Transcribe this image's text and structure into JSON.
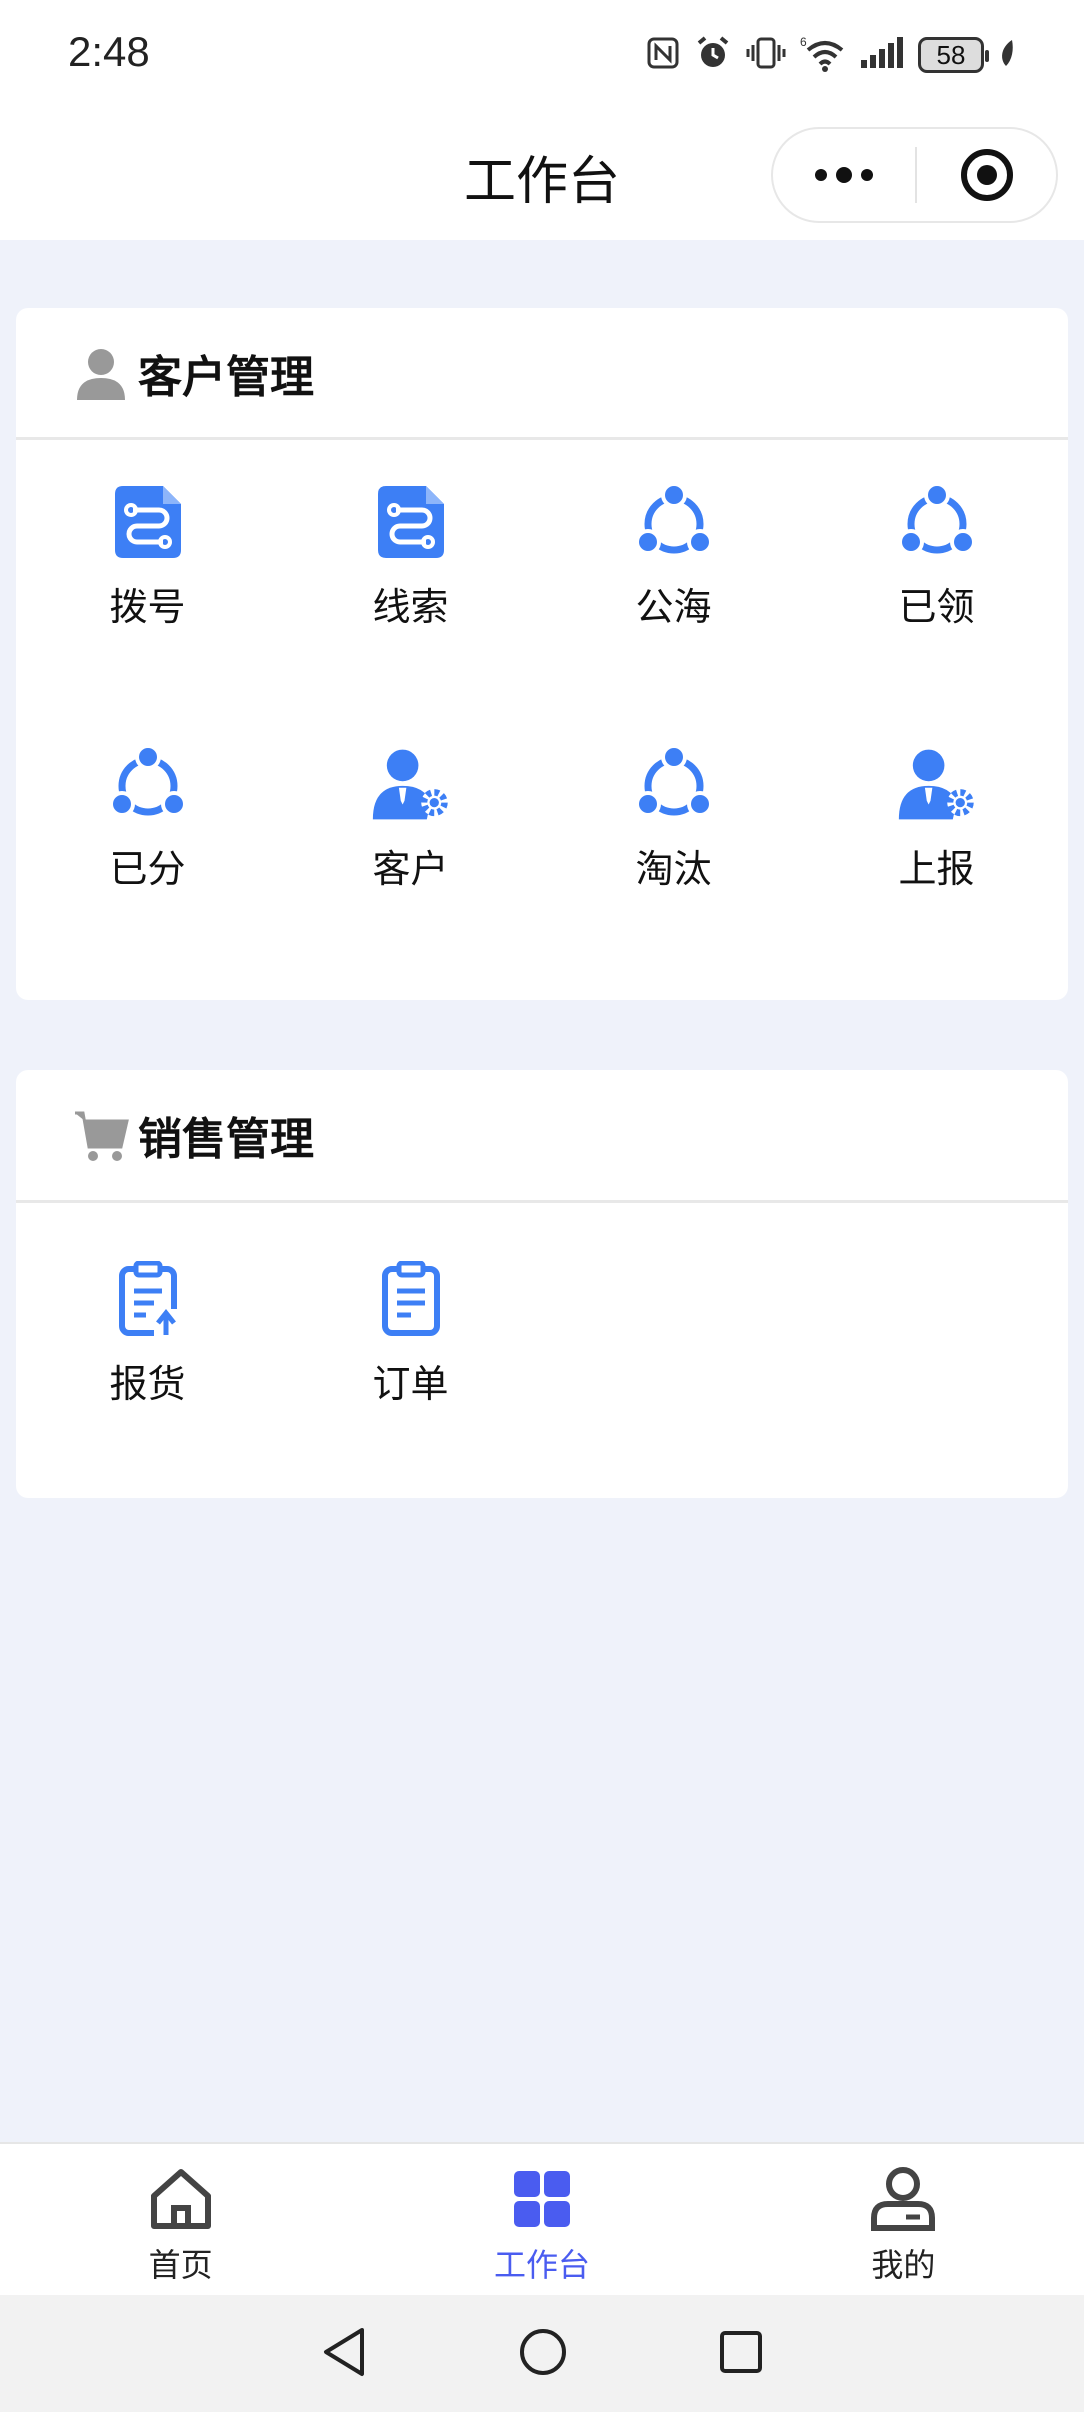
{
  "status_bar": {
    "time": "2:48",
    "battery": "58",
    "network": "6"
  },
  "nav": {
    "title": "工作台"
  },
  "customer_section": {
    "title": "客户管理",
    "items": [
      {
        "label": "拨号",
        "icon": "route-doc-icon"
      },
      {
        "label": "线索",
        "icon": "route-doc-icon"
      },
      {
        "label": "公海",
        "icon": "share-nodes-icon"
      },
      {
        "label": "已领",
        "icon": "share-nodes-icon"
      },
      {
        "label": "已分",
        "icon": "share-nodes-icon"
      },
      {
        "label": "客户",
        "icon": "user-gear-icon"
      },
      {
        "label": "淘汰",
        "icon": "share-nodes-icon"
      },
      {
        "label": "上报",
        "icon": "user-gear-icon"
      }
    ]
  },
  "sales_section": {
    "title": "销售管理",
    "items": [
      {
        "label": "报货",
        "icon": "clipboard-upload-icon"
      },
      {
        "label": "订单",
        "icon": "clipboard-icon"
      }
    ]
  },
  "tab_bar": {
    "items": [
      {
        "label": "首页",
        "icon": "home-icon"
      },
      {
        "label": "工作台",
        "icon": "grid-icon",
        "active": true
      },
      {
        "label": "我的",
        "icon": "profile-icon"
      }
    ]
  },
  "colors": {
    "accent": "#3d7ff5",
    "tab_active": "#4a5cf0",
    "page_bg": "#eff2fa"
  }
}
